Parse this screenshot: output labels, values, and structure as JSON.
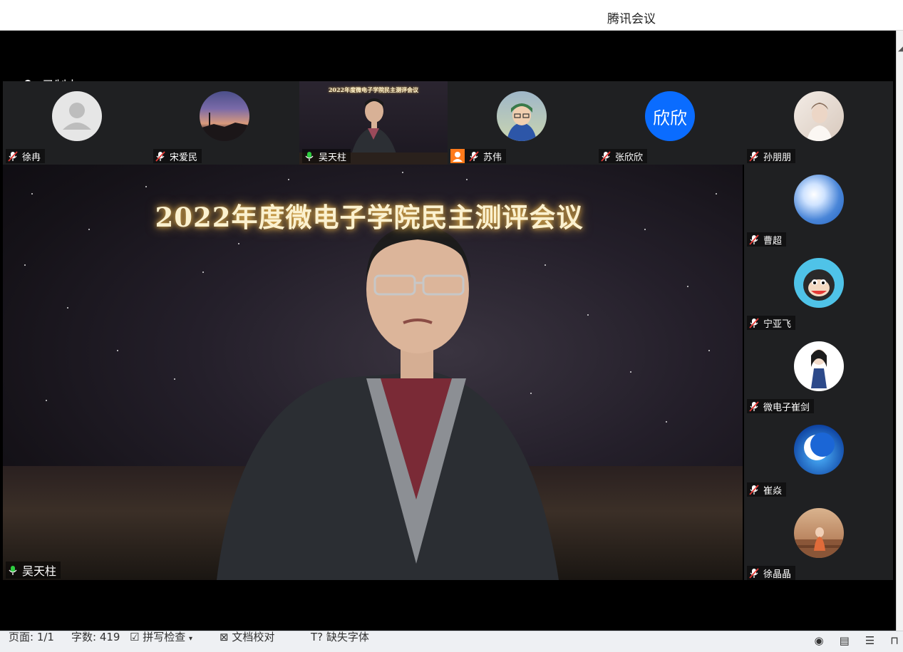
{
  "window": {
    "title": "腾讯会议"
  },
  "meeting": {
    "recording_label": "录制中",
    "active_speaker": {
      "name": "吴天柱",
      "background_title": "2022年度微电子学院民主测评会议"
    },
    "top_participants": [
      {
        "name": "徐冉",
        "muted": true,
        "avatar": "default-person-icon"
      },
      {
        "name": "宋爱民",
        "muted": true,
        "avatar": "sunset-photo"
      },
      {
        "name": "吴天柱",
        "muted": false,
        "avatar": "video-feed",
        "video_title": "2022年度微电子学院民主测评会议"
      },
      {
        "name": "苏伟",
        "muted": true,
        "avatar": "child-photo",
        "host_badge": true
      },
      {
        "name": "张欣欣",
        "muted": true,
        "avatar": "text-avatar",
        "avatar_text": "欣欣"
      },
      {
        "name": "孙朋朋",
        "muted": true,
        "avatar": "bride-photo"
      }
    ],
    "side_participants": [
      {
        "name": "曹超",
        "muted": true,
        "avatar": "sky-clouds-photo"
      },
      {
        "name": "宁亚飞",
        "muted": true,
        "avatar": "monkey-cartoon"
      },
      {
        "name": "微电子崔剑",
        "muted": true,
        "avatar": "girl-illustration"
      },
      {
        "name": "崔焱",
        "muted": true,
        "avatar": "moon-ocean-art"
      },
      {
        "name": "徐晶晶",
        "muted": true,
        "avatar": "stairs-photo"
      }
    ]
  },
  "statusbar": {
    "page": "页面: 1/1",
    "words": "字数: 419",
    "spellcheck": "拼写检查",
    "proofread": "文档校对",
    "missing_font": "缺失字体"
  },
  "colors": {
    "accent_blue": "#0a6cff",
    "mic_active": "#2ecc40",
    "mic_muted": "#ffffff",
    "muted_slash": "#e53935",
    "tile_bg": "#1f2022"
  }
}
